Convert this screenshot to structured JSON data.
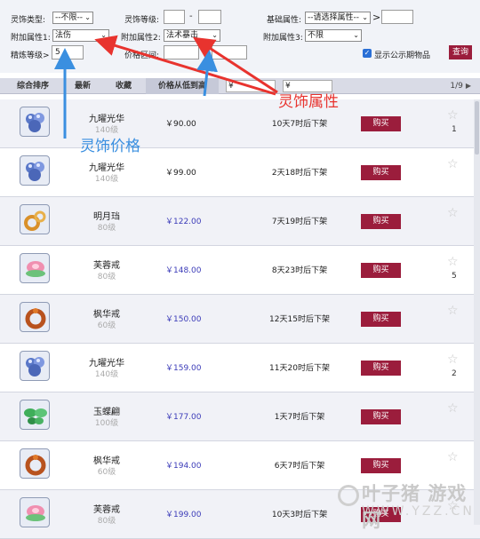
{
  "filters": {
    "type_label": "灵饰类型:",
    "type_value": "--不限--",
    "level_label": "灵饰等级:",
    "level_dash": "-",
    "base_attr_label": "基础属性:",
    "base_attr_value": "--请选择属性--",
    "base_attr_cmp": ">",
    "extra1_label": "附加属性1:",
    "extra1_value": "法伤",
    "extra2_label": "附加属性2:",
    "extra2_value": "法术暴击",
    "extra3_label": "附加属性3:",
    "extra3_value": "不限",
    "forge_label": "精炼等级>",
    "forge_value": "5",
    "price_range_label": "价格区间:",
    "price_dash": "-",
    "show_public_label": "显示公示期物品",
    "query_button": "查询"
  },
  "sort_bar": {
    "tabs": [
      "综合排序",
      "最新",
      "收藏",
      "价格从低到高"
    ],
    "price_from": "¥",
    "price_to": "¥",
    "page": "1/9"
  },
  "items": [
    {
      "name": "九曜光华",
      "level": "140级",
      "price": "￥90.00",
      "time": "10天7时后下架",
      "buy": "购买",
      "favorites": "1"
    },
    {
      "name": "九曜光华",
      "level": "140级",
      "price": "￥99.00",
      "time": "2天18时后下架",
      "buy": "购买",
      "favorites": ""
    },
    {
      "name": "明月珰",
      "level": "80级",
      "price": "￥122.00",
      "time": "7天19时后下架",
      "buy": "购买",
      "favorites": ""
    },
    {
      "name": "芙蓉戒",
      "level": "80级",
      "price": "￥148.00",
      "time": "8天23时后下架",
      "buy": "购买",
      "favorites": "5"
    },
    {
      "name": "枫华戒",
      "level": "60级",
      "price": "￥150.00",
      "time": "12天15时后下架",
      "buy": "购买",
      "favorites": ""
    },
    {
      "name": "九曜光华",
      "level": "140级",
      "price": "￥159.00",
      "time": "11天20时后下架",
      "buy": "购买",
      "favorites": "2"
    },
    {
      "name": "玉蝶翩",
      "level": "100级",
      "price": "￥177.00",
      "time": "1天7时后下架",
      "buy": "购买",
      "favorites": ""
    },
    {
      "name": "枫华戒",
      "level": "60级",
      "price": "￥194.00",
      "time": "6天7时后下架",
      "buy": "购买",
      "favorites": ""
    },
    {
      "name": "芙蓉戒",
      "level": "80级",
      "price": "￥199.00",
      "time": "10天3时后下架",
      "buy": "购买",
      "favorites": ""
    }
  ],
  "annotations": {
    "red": "灵饰属性",
    "blue": "灵饰价格"
  },
  "watermark": {
    "line1": "叶子猪 游戏网",
    "line2": "WWW.YZZ.CN"
  }
}
